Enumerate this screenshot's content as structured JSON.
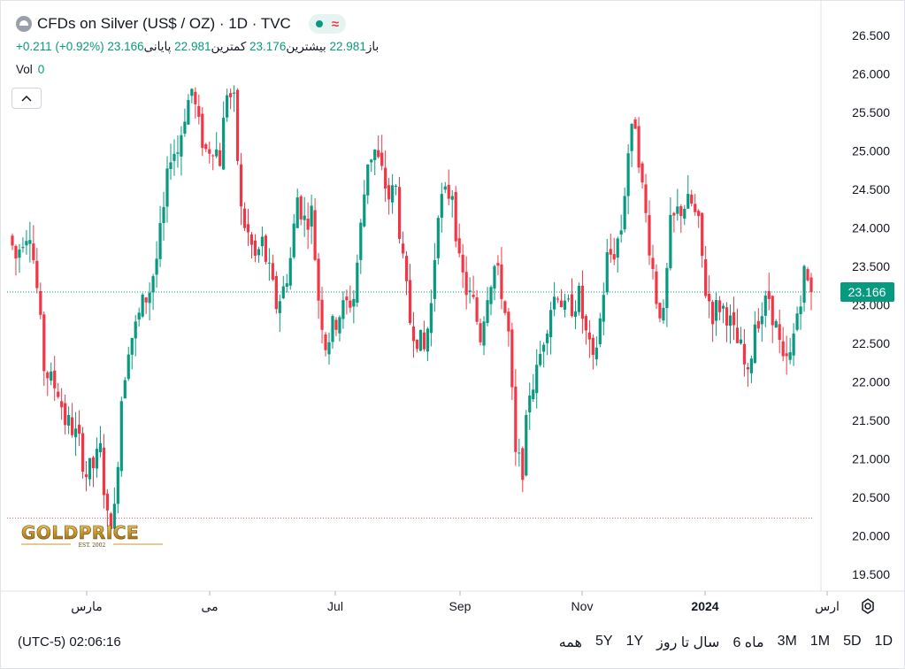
{
  "header": {
    "title": "CFDs on Silver (US$ / OZ) · 1D · TVC",
    "ohlc": {
      "open_label": "باز",
      "open": "22.981",
      "high_label": "بیشترین",
      "high": "23.176",
      "low_label": "کمترین",
      "low": "22.981",
      "close_label": "پایانی",
      "close": "23.166",
      "change": "+0.211 (+0.92%)"
    },
    "volume_label": "Vol",
    "volume": "0"
  },
  "price_axis": {
    "ticks": [
      "26.500",
      "26.000",
      "25.500",
      "25.000",
      "24.500",
      "24.000",
      "23.500",
      "23.000",
      "22.500",
      "22.000",
      "21.500",
      "21.000",
      "20.500",
      "20.000",
      "19.500"
    ],
    "last_price": "23.166"
  },
  "time_axis": {
    "labels": [
      "مارس",
      "می",
      "Jul",
      "Sep",
      "Nov",
      "2024",
      "ارس"
    ]
  },
  "logo": {
    "text": "GOLDPRICE",
    "tagline": "EST. 2002"
  },
  "bottom_bar": {
    "clock": "(UTC-5) 02:06:16",
    "ranges": [
      "1D",
      "5D",
      "1M",
      "3M",
      "6 ماه",
      "سال تا روز",
      "1Y",
      "5Y",
      "همه"
    ]
  },
  "colors": {
    "up": "#089981",
    "down": "#f23645",
    "last_price_bg": "#089981",
    "reference_line": "#f23645"
  },
  "chart_data": {
    "type": "candlestick",
    "title": "CFDs on Silver (US$ / OZ) · 1D · TVC",
    "ylim": [
      19.3,
      26.7
    ],
    "y_ticks": [
      26.5,
      26.0,
      25.5,
      25.0,
      24.5,
      24.0,
      23.5,
      23.0,
      22.5,
      22.0,
      21.5,
      21.0,
      20.5,
      20.0,
      19.5
    ],
    "x_labels": [
      "مارس",
      "می",
      "Jul",
      "Sep",
      "Nov",
      "2024",
      "ارس"
    ],
    "last_price": 23.166,
    "reference_low": 20.23,
    "price_path": [
      [
        0,
        23.9
      ],
      [
        2,
        23.6
      ],
      [
        4,
        23.9
      ],
      [
        6,
        24.0
      ],
      [
        8,
        23.2
      ],
      [
        10,
        22.2
      ],
      [
        12,
        22.0
      ],
      [
        14,
        21.9
      ],
      [
        16,
        21.5
      ],
      [
        18,
        21.4
      ],
      [
        20,
        21.2
      ],
      [
        22,
        20.8
      ],
      [
        24,
        20.9
      ],
      [
        26,
        21.1
      ],
      [
        28,
        20.2
      ],
      [
        30,
        20.3
      ],
      [
        32,
        21.8
      ],
      [
        34,
        22.5
      ],
      [
        36,
        22.7
      ],
      [
        38,
        23.0
      ],
      [
        40,
        23.2
      ],
      [
        42,
        23.6
      ],
      [
        44,
        24.2
      ],
      [
        46,
        25.0
      ],
      [
        48,
        25.0
      ],
      [
        50,
        25.5
      ],
      [
        52,
        25.8
      ],
      [
        54,
        25.3
      ],
      [
        56,
        25.0
      ],
      [
        58,
        25.1
      ],
      [
        60,
        24.9
      ],
      [
        62,
        25.8
      ],
      [
        64,
        25.6
      ],
      [
        66,
        24.2
      ],
      [
        68,
        23.9
      ],
      [
        70,
        23.6
      ],
      [
        72,
        23.8
      ],
      [
        74,
        23.4
      ],
      [
        76,
        23.0
      ],
      [
        78,
        23.2
      ],
      [
        80,
        23.6
      ],
      [
        82,
        24.4
      ],
      [
        84,
        24.1
      ],
      [
        86,
        24.2
      ],
      [
        88,
        23.1
      ],
      [
        90,
        22.5
      ],
      [
        92,
        22.7
      ],
      [
        94,
        22.9
      ],
      [
        96,
        23.0
      ],
      [
        98,
        23.1
      ],
      [
        100,
        24.0
      ],
      [
        102,
        24.9
      ],
      [
        104,
        25.0
      ],
      [
        106,
        24.7
      ],
      [
        108,
        24.4
      ],
      [
        110,
        24.5
      ],
      [
        112,
        23.5
      ],
      [
        114,
        22.8
      ],
      [
        116,
        22.6
      ],
      [
        118,
        22.4
      ],
      [
        120,
        23.0
      ],
      [
        122,
        24.3
      ],
      [
        124,
        24.4
      ],
      [
        126,
        24.5
      ],
      [
        128,
        23.5
      ],
      [
        130,
        23.2
      ],
      [
        132,
        23.0
      ],
      [
        134,
        22.6
      ],
      [
        136,
        23.2
      ],
      [
        138,
        23.5
      ],
      [
        140,
        23.2
      ],
      [
        142,
        22.6
      ],
      [
        144,
        21.0
      ],
      [
        146,
        20.9
      ],
      [
        148,
        21.9
      ],
      [
        150,
        22.1
      ],
      [
        152,
        22.6
      ],
      [
        154,
        23.0
      ],
      [
        156,
        23.2
      ],
      [
        158,
        22.9
      ],
      [
        160,
        23.0
      ],
      [
        162,
        23.1
      ],
      [
        164,
        22.6
      ],
      [
        166,
        22.2
      ],
      [
        168,
        22.8
      ],
      [
        170,
        23.6
      ],
      [
        172,
        23.7
      ],
      [
        174,
        24.0
      ],
      [
        176,
        25.0
      ],
      [
        178,
        25.4
      ],
      [
        180,
        24.5
      ],
      [
        182,
        23.8
      ],
      [
        184,
        23.1
      ],
      [
        186,
        22.8
      ],
      [
        188,
        24.0
      ],
      [
        190,
        24.2
      ],
      [
        192,
        24.3
      ],
      [
        194,
        24.3
      ],
      [
        196,
        24.0
      ],
      [
        198,
        23.2
      ],
      [
        200,
        22.9
      ],
      [
        202,
        23.0
      ],
      [
        204,
        22.9
      ],
      [
        206,
        22.6
      ],
      [
        208,
        22.4
      ],
      [
        210,
        22.0
      ],
      [
        212,
        22.8
      ],
      [
        214,
        22.9
      ],
      [
        216,
        23.1
      ],
      [
        218,
        22.7
      ],
      [
        220,
        22.2
      ],
      [
        222,
        22.3
      ],
      [
        224,
        22.9
      ],
      [
        226,
        23.4
      ],
      [
        228,
        23.166
      ]
    ]
  }
}
